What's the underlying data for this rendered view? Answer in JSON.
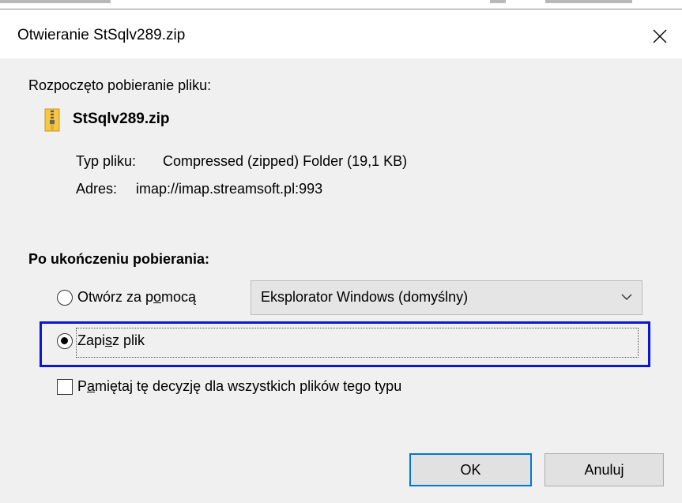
{
  "dialog": {
    "title": "Otwieranie StSqlv289.zip",
    "close_symbol": "✕"
  },
  "download": {
    "heading": "Rozpoczęto pobieranie pliku:",
    "file_icon": "zip-file-icon",
    "filename": "StSqlv289.zip",
    "type_label": "Typ pliku:",
    "type_value": "Compressed (zipped) Folder (19,1 KB)",
    "address_label": "Adres:",
    "address_value": "imap://imap.streamsoft.pl:993"
  },
  "after": {
    "heading": "Po ukończeniu pobierania:",
    "open_with": {
      "label_pre": "Otwórz za p",
      "label_mnemonic": "o",
      "label_post": "mocą",
      "checked": false,
      "app": "Eksplorator Windows (domyślny)"
    },
    "save_file": {
      "label_pre": "Zapi",
      "label_mnemonic": "s",
      "label_post": "z plik",
      "checked": true
    },
    "remember": {
      "label_pre": "P",
      "label_mnemonic": "a",
      "label_post": "miętaj tę decyzję dla wszystkich plików tego typu",
      "checked": false
    }
  },
  "buttons": {
    "ok": "OK",
    "cancel": "Anuluj"
  },
  "colors": {
    "focus_outline": "#0a18d6",
    "default_button_border": "#0078d7",
    "dialog_bg": "#f0f0f0"
  }
}
